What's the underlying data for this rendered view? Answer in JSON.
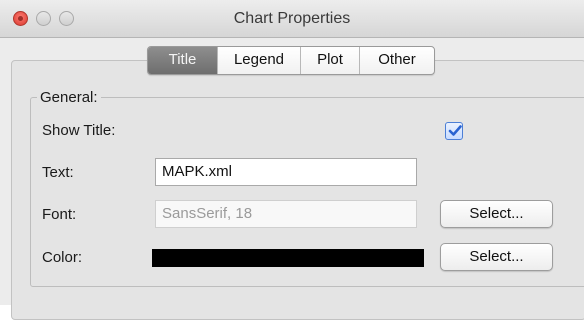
{
  "window": {
    "title": "Chart Properties",
    "controls": [
      "close-button",
      "minimize-button",
      "zoom-button"
    ]
  },
  "tabs": [
    {
      "label": "Title",
      "selected": true
    },
    {
      "label": "Legend",
      "selected": false
    },
    {
      "label": "Plot",
      "selected": false
    },
    {
      "label": "Other",
      "selected": false
    }
  ],
  "general": {
    "group_label": "General:",
    "show_title": {
      "label": "Show Title:",
      "checked": true
    },
    "text": {
      "label": "Text:",
      "value": "MAPK.xml"
    },
    "font": {
      "label": "Font:",
      "value": "SansSerif, 18",
      "button": "Select..."
    },
    "color": {
      "label": "Color:",
      "value": "#000000",
      "button": "Select..."
    }
  },
  "colors": {
    "selected_tab": "#7a7a7a",
    "checkbox_accent": "#2a63d1",
    "close_button": "#e0443a"
  }
}
